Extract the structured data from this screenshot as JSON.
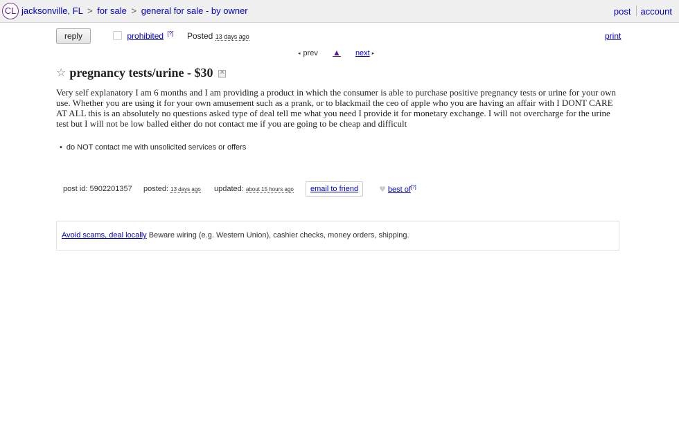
{
  "header": {
    "logo": "CL",
    "breadcrumbs": [
      "jacksonville, FL",
      "for sale",
      "general for sale - by owner"
    ],
    "separator": ">",
    "post_link": "post",
    "account_link": "account"
  },
  "toolbar": {
    "reply_label": "reply",
    "prohibited_label": "prohibited",
    "prohibited_help": "[?]",
    "posted_label": "Posted",
    "posted_ago": "13 days ago",
    "print_label": "print"
  },
  "pager": {
    "prev": "prev",
    "up": "▲",
    "next": "next"
  },
  "listing": {
    "title": "pregnancy tests/urine - $30",
    "body": "Very self explanatory I am 6 months and I am providing a product in which the consumer is able to purchase positive pregnancy tests or urine for your own use. Whether you are using it for your own amusement such as a prank, or to blackmail the ceo of apple who you are having an affair with I DONT CARE AT ALL this is an absolutely no questions asked type of deal tell me what you need I provide it for monetary exchange. I will not overcharge for the urine test but I will not be low balled either do not contact me if you are going to be cheap and difficult",
    "notices": [
      "do NOT contact me with unsolicited services or offers"
    ]
  },
  "meta": {
    "post_id_label": "post id:",
    "post_id": "5902201357",
    "posted_label": "posted:",
    "posted_value": "13 days ago",
    "updated_label": "updated:",
    "updated_value": "about 15 hours ago",
    "email_label": "email to friend",
    "bestof_label": "best of",
    "bestof_help": "[?]"
  },
  "safety": {
    "link_text": "Avoid scams, deal locally",
    "text": "Beware wiring (e.g. Western Union), cashier checks, money orders, shipping."
  },
  "icons": {
    "star": "☆",
    "heart": "♥",
    "prev_arrow": "◂",
    "next_arrow": "▸"
  }
}
